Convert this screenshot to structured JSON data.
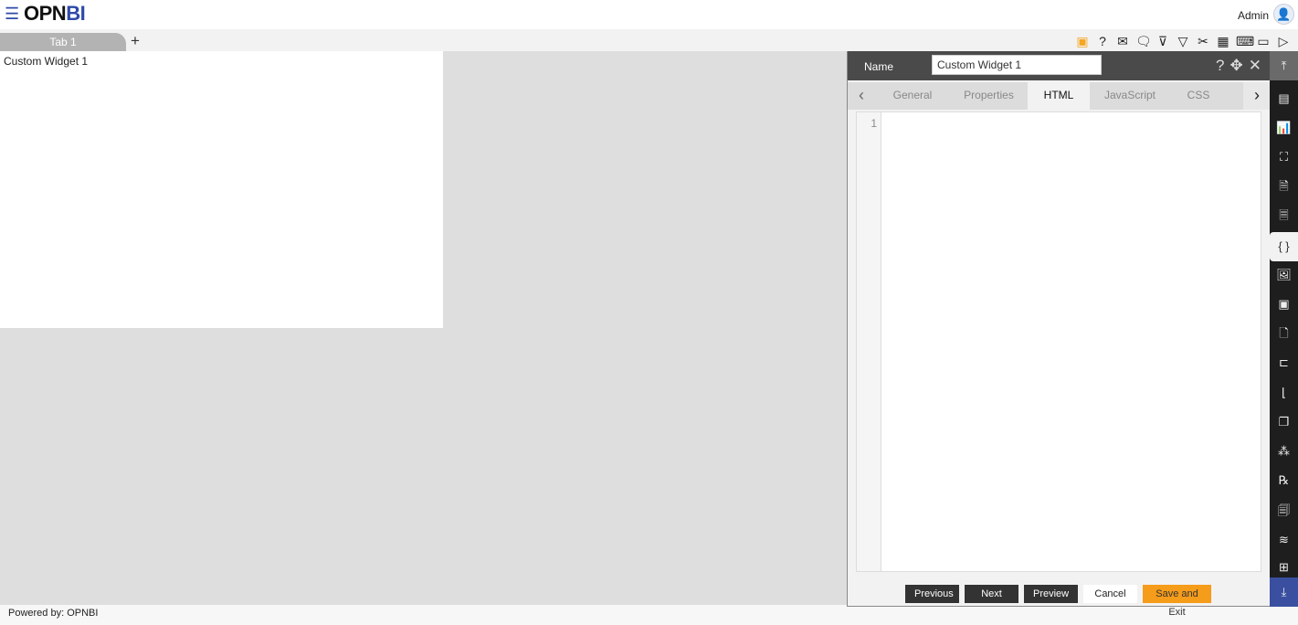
{
  "header": {
    "logo": {
      "part1": "OPN",
      "part2": "BI"
    },
    "user": "Admin",
    "menu_icon": "hamburger-icon",
    "avatar_icon": "user-avatar-icon"
  },
  "tabs": {
    "items": [
      {
        "label": "Tab 1"
      }
    ],
    "add_label": "+"
  },
  "toolbar": {
    "icons": [
      "save-icon",
      "help-icon",
      "mail-icon",
      "comment-icon",
      "clear-filter-icon",
      "filter-icon",
      "tools-icon",
      "table-icon",
      "embed-icon",
      "devices-icon",
      "play-icon"
    ],
    "accent": "#f5a623"
  },
  "canvas": {
    "widget_title": "Custom Widget 1"
  },
  "footer": {
    "text": "Powered by: OPNBI"
  },
  "panel": {
    "name_label": "Name",
    "name_value": "Custom Widget 1",
    "tabs": [
      {
        "label": "General"
      },
      {
        "label": "Properties"
      },
      {
        "label": "HTML",
        "active": true
      },
      {
        "label": "JavaScript"
      },
      {
        "label": "CSS"
      }
    ],
    "editor": {
      "line_numbers": [
        "1"
      ],
      "content": ""
    },
    "buttons": {
      "previous": "Previous",
      "next": "Next",
      "preview": "Preview",
      "cancel": "Cancel",
      "save_exit": "Save and Exit"
    },
    "colors": {
      "save_exit": "#f59c1a",
      "header": "#4a4a4a",
      "rail": "#1e1e1e",
      "rail_bottom": "#3a4fa0"
    }
  },
  "rail": {
    "items": [
      "card-icon",
      "bar-line-chart-icon",
      "map-icon",
      "report-icon",
      "document-icon",
      "code-braces-icon",
      "image-icon",
      "calendar-icon",
      "file-icon",
      "tree-icon",
      "chart-icon",
      "copy-icon",
      "cubes-icon",
      "rx-icon",
      "form-icon",
      "layers-icon",
      "grid-icon"
    ],
    "active": "code-braces-icon"
  }
}
